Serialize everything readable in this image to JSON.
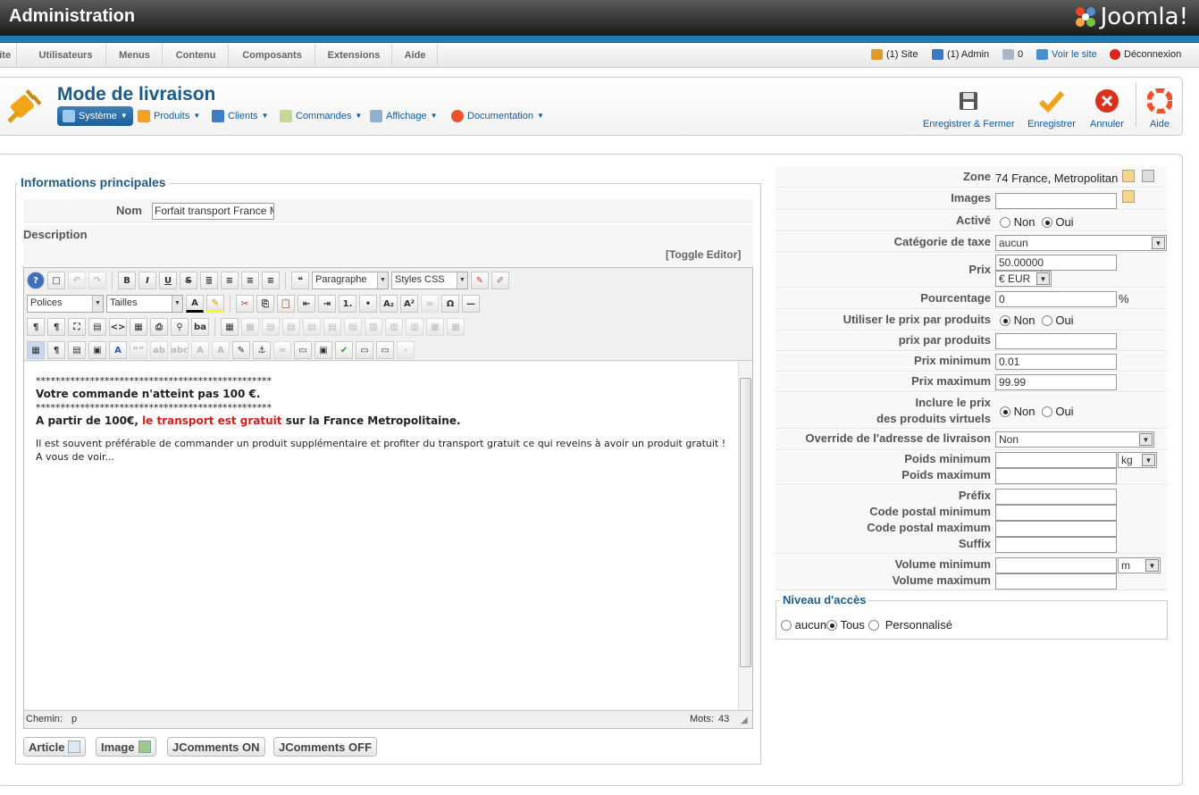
{
  "header": {
    "title": "Administration",
    "logo_text": "Joomla!"
  },
  "menu": {
    "items": [
      "Site",
      "Utilisateurs",
      "Menus",
      "Contenu",
      "Composants",
      "Extensions",
      "Aide"
    ]
  },
  "status": {
    "site": "(1) Site",
    "admin": "(1) Admin",
    "messages": "0",
    "view_site": "Voir le site",
    "logout": "Déconnexion"
  },
  "page": {
    "title": "Mode de livraison"
  },
  "submenu": [
    "Système",
    "Produits",
    "Clients",
    "Commandes",
    "Affichage",
    "Documentation"
  ],
  "toolbar": {
    "save_close": "Enregistrer & Fermer",
    "save": "Enregistrer",
    "cancel": "Annuler",
    "help": "Aide"
  },
  "main": {
    "legend": "Informations principales",
    "nom_label": "Nom",
    "nom_value": "Forfait transport France M",
    "description_label": "Description",
    "toggle_editor": "[Toggle Editor]"
  },
  "editor": {
    "format_select": "Paragraphe",
    "styles_select": "Styles CSS",
    "font_select": "Polices",
    "size_select": "Tailles",
    "stars": "************************************************",
    "line1": "Votre commande n'atteint pas 100 €.",
    "line2_a": "A partir de 100€, ",
    "line2_red": "le transport est gratuit",
    "line2_b": " sur la France Metropolitaine.",
    "para": "Il est souvent préférable de commander un produit supplémentaire et profiter du transport gratuit ce qui reveins à avoir un produit gratuit !",
    "para2": "A vous de voir...",
    "path_label": "Chemin:",
    "path_value": "p",
    "words_label": "Mots:",
    "words_value": "43"
  },
  "editor_buttons": [
    "Article",
    "Image",
    "JComments ON",
    "JComments OFF"
  ],
  "form": {
    "zone_label": "Zone",
    "zone_value": "74 France, Metropolitan",
    "images_label": "Images",
    "active_label": "Activé",
    "non": "Non",
    "oui": "Oui",
    "tax_label": "Catégorie de taxe",
    "tax_value": "aucun",
    "price_label": "Prix",
    "price_value": "50.00000",
    "currency_value": "€ EUR",
    "percent_label": "Pourcentage",
    "percent_value": "0",
    "percent_sign": "%",
    "use_price_label": "Utiliser le prix par produits",
    "price_per_label": "prix par produits",
    "min_price_label": "Prix minimum",
    "min_price_value": "0.01",
    "max_price_label": "Prix maximum",
    "max_price_value": "99.99",
    "virtual_label_1": "Inclure le prix",
    "virtual_label_2": "des produits virtuels",
    "override_label": "Override de l'adresse de livraison",
    "override_value": "Non",
    "min_weight_label": "Poids minimum",
    "weight_unit": "kg",
    "max_weight_label": "Poids maximum",
    "prefix_label": "Préfix",
    "min_zip_label": "Code postal minimum",
    "max_zip_label": "Code postal maximum",
    "suffix_label": "Suffix",
    "min_volume_label": "Volume minimum",
    "volume_unit": "m",
    "max_volume_label": "Volume maximum"
  },
  "access": {
    "legend": "Niveau d'accès",
    "opt1": "aucun",
    "opt2": "Tous",
    "opt3": "Personnalisé"
  },
  "colors": {
    "brand_blue": "#1d7ab4",
    "title_blue": "#1e5a8a",
    "link_blue": "#155a9e",
    "danger": "#d0201a"
  }
}
